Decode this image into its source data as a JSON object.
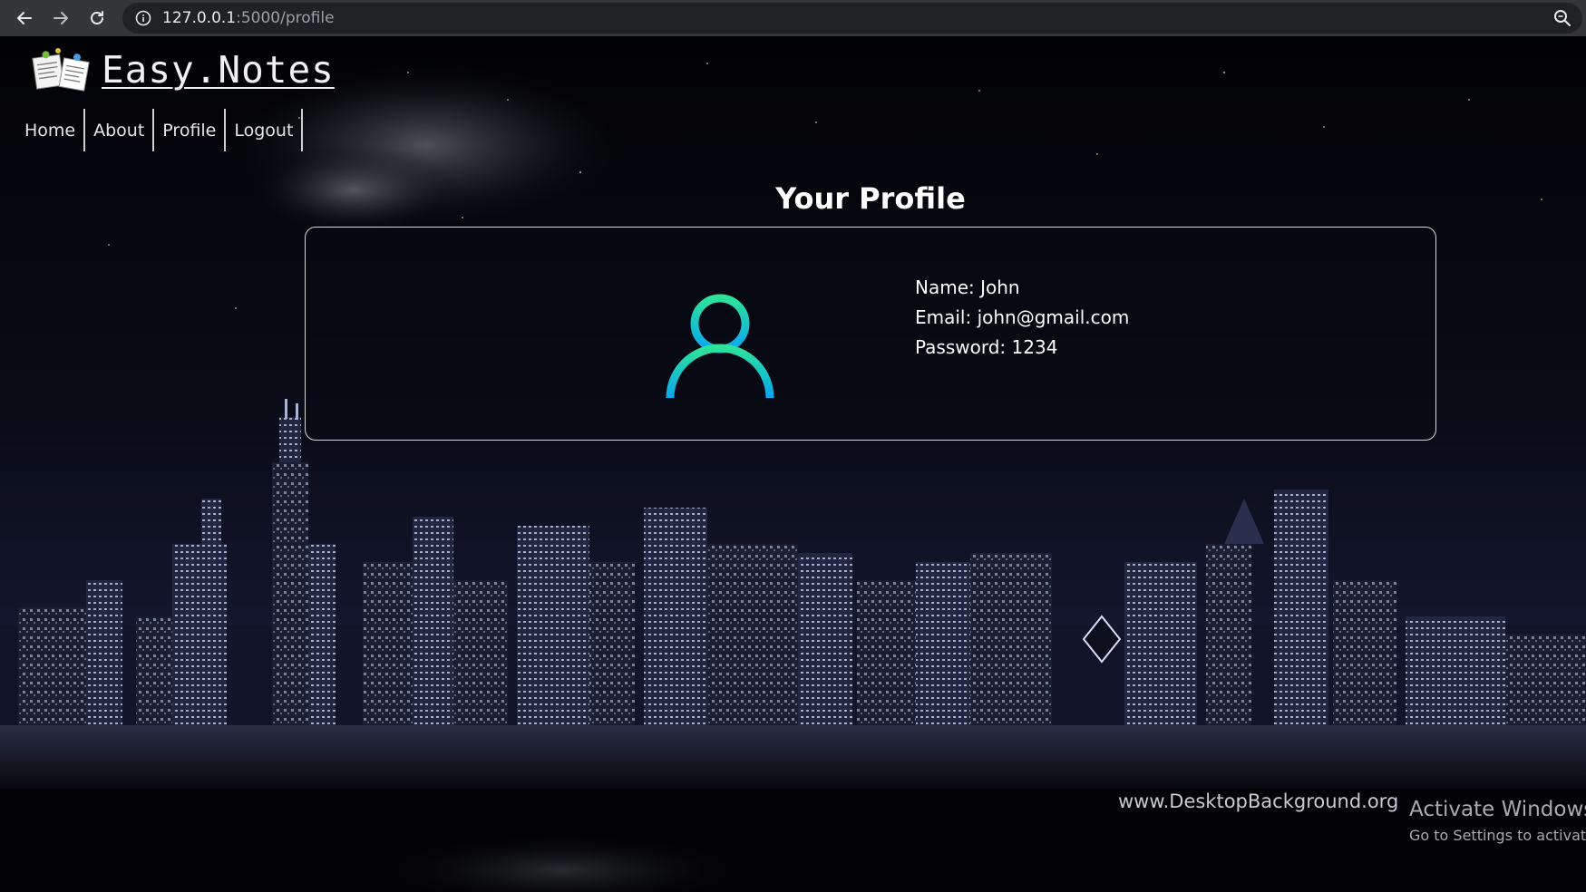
{
  "browser": {
    "url_host": "127.0.0.1",
    "url_path": ":5000/profile"
  },
  "site": {
    "brand": "Easy.Notes",
    "nav": [
      "Home",
      "About",
      "Profile",
      "Logout"
    ]
  },
  "profile": {
    "title": "Your Profile",
    "name_line": "Name: John",
    "email_line": "Email: john@gmail.com",
    "password_line": "Password: 1234",
    "avatar_icon": "user-icon",
    "avatar_gradient": [
      "#2de39a",
      "#0aa6f0"
    ]
  },
  "background": {
    "watermark": "www.DesktopBackground.org"
  },
  "os_overlay": {
    "title": "Activate Windows",
    "subtitle": "Go to Settings to activate"
  }
}
